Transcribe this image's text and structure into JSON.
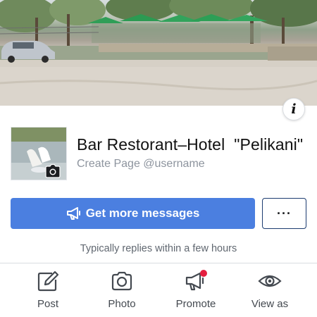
{
  "page": {
    "name": "Bar Restorant–Hotel  \"Pelikani\"",
    "username": "Create Page @username"
  },
  "icons": {
    "info": "info-icon",
    "camera": "camera-icon",
    "megaphone": "megaphone-icon",
    "more": "more-icon",
    "post": "edit-icon",
    "photo": "camera-icon",
    "promote": "megaphone-icon",
    "view_as": "eye-icon"
  },
  "info_glyph": "i",
  "cta": {
    "label": "Get more messages"
  },
  "more_label": "···",
  "reply_time": "Typically replies within a few hours",
  "actions": [
    {
      "label": "Post"
    },
    {
      "label": "Photo"
    },
    {
      "label": "Promote"
    },
    {
      "label": "View as"
    }
  ],
  "colors": {
    "primary": "#4b7fe0",
    "notification_dot": "#e41e3f",
    "border_dark": "#1c3c70"
  }
}
